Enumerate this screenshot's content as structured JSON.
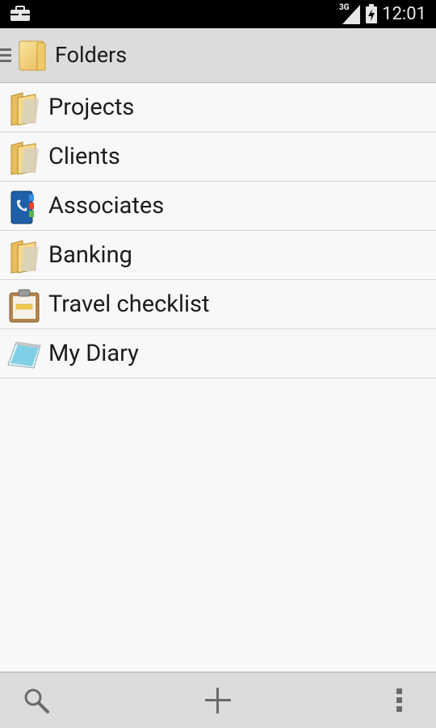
{
  "status_bar": {
    "time": "12:01",
    "network_type": "3G",
    "icons": [
      "briefcase-icon",
      "signal-icon",
      "battery-icon"
    ]
  },
  "action_bar": {
    "title": "Folders",
    "icons": [
      "drawer-icon",
      "folder-icon"
    ]
  },
  "folders": [
    {
      "label": "Projects",
      "icon": "folder-icon"
    },
    {
      "label": "Clients",
      "icon": "folder-icon"
    },
    {
      "label": "Associates",
      "icon": "address-book-icon"
    },
    {
      "label": "Banking",
      "icon": "folder-icon"
    },
    {
      "label": "Travel checklist",
      "icon": "clipboard-icon"
    },
    {
      "label": "My Diary",
      "icon": "notepad-icon"
    }
  ],
  "bottom_bar": {
    "icons": [
      "search-icon",
      "add-icon",
      "overflow-menu-icon"
    ]
  },
  "colors": {
    "status_bar_bg": "#000000",
    "action_bar_bg": "#dcdcdc",
    "list_bg": "#f8f8f8",
    "divider": "#d6d6d6",
    "folder_yellow": "#f3d37a"
  }
}
